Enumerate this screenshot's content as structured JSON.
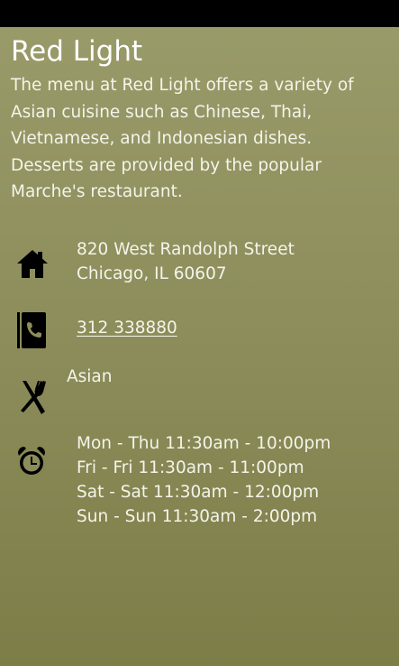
{
  "restaurant": {
    "name": "Red Light",
    "description": "The menu at Red Light offers a variety of Asian cuisine such as Chinese, Thai, Vietnamese, and Indonesian dishes. Desserts are provided by the popular Marche's restaurant."
  },
  "address": {
    "icon": "home-icon",
    "line1": "820 West Randolph Street",
    "line2": "Chicago, IL 60607"
  },
  "phone": {
    "icon": "phone-icon",
    "number": "312 338880"
  },
  "cuisine": {
    "icon": "fork-knife-icon",
    "label": "Asian"
  },
  "hours": {
    "icon": "alarm-clock-icon",
    "lines": [
      "Mon - Thu 11:30am - 10:00pm",
      "Fri - Fri 11:30am - 11:00pm",
      "Sat - Sat 11:30am - 12:00pm",
      "Sun - Sun 11:30am - 2:00pm"
    ]
  },
  "colors": {
    "background_top": "#999a69",
    "background_bottom": "#7d7d48",
    "text": "#ffffff",
    "icon": "#000000"
  }
}
